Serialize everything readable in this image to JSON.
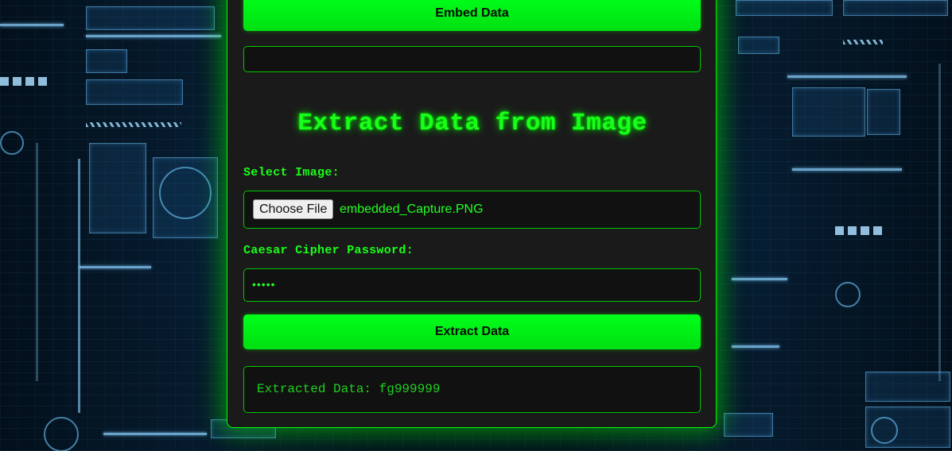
{
  "embed_section": {
    "button_label": "Embed Data",
    "output_text": ""
  },
  "extract_section": {
    "title": "Extract Data from Image",
    "select_image_label": "Select Image:",
    "choose_file_button": "Choose File",
    "selected_file_name": "embedded_Capture.PNG",
    "password_label": "Caesar Cipher Password:",
    "password_value": "•••••",
    "button_label": "Extract Data",
    "result_text": "Extracted Data: fg999999"
  },
  "colors": {
    "accent_green": "#00ff00",
    "card_background": "#1a1a1a",
    "background_hud": "#03101c"
  }
}
